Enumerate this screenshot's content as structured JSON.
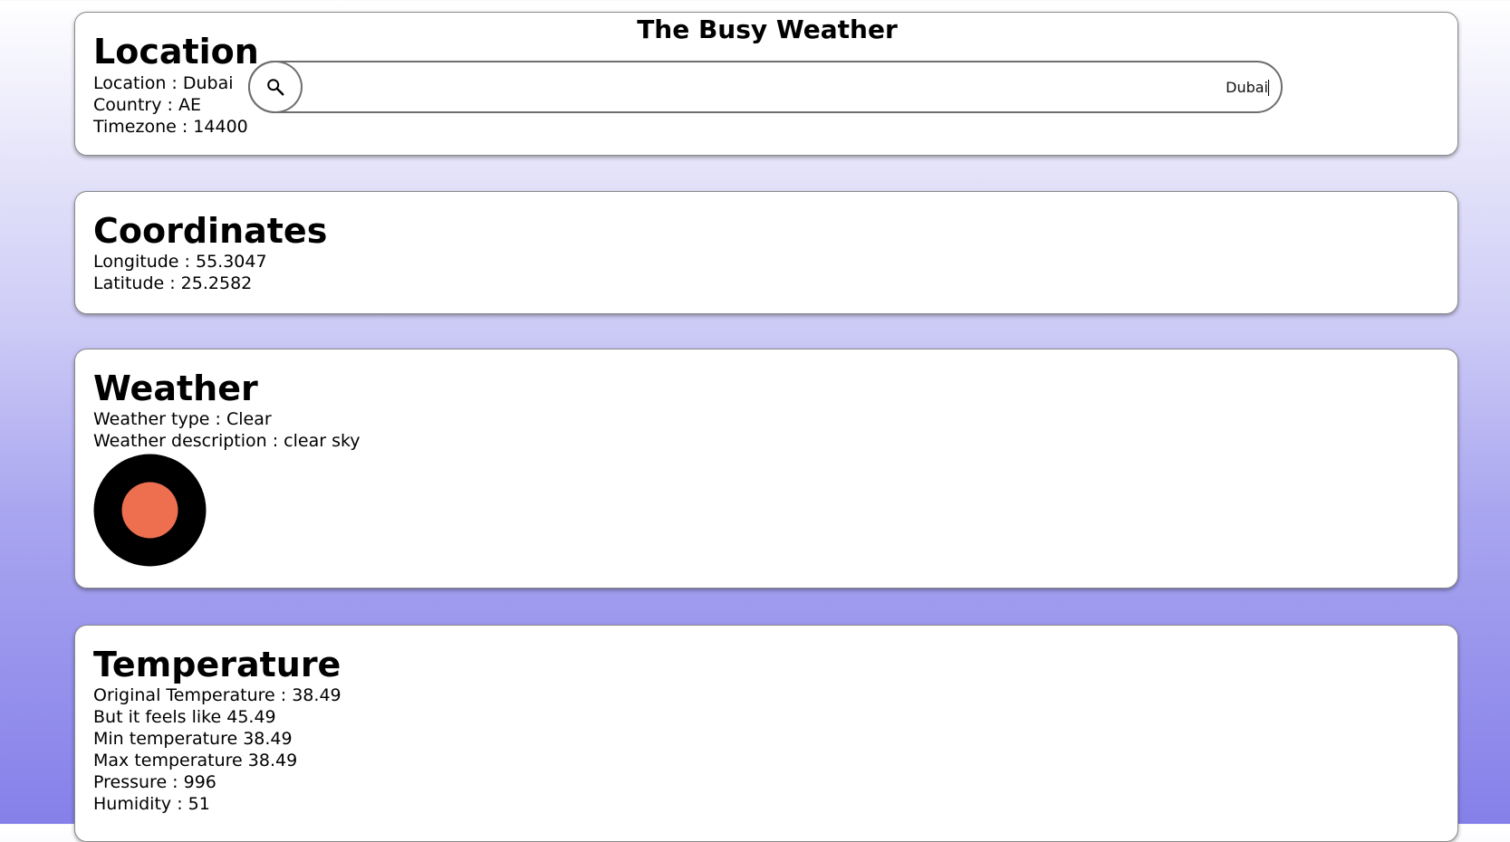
{
  "app": {
    "title": "The Busy Weather"
  },
  "search": {
    "value": "Dubai",
    "icon": "search-icon"
  },
  "location": {
    "heading": "Location",
    "location_line": "Location : Dubai",
    "country_line": "Country : AE",
    "timezone_line": "Timezone : 14400"
  },
  "coordinates": {
    "heading": "Coordinates",
    "longitude_line": "Longitude : 55.3047",
    "latitude_line": "Latitude : 25.2582"
  },
  "weather": {
    "heading": "Weather",
    "type_line": "Weather type : Clear",
    "description_line": "Weather description : clear sky",
    "icon": "clear-sky-sun-icon",
    "icon_outer_color": "#000000",
    "icon_inner_color": "#ee6e50"
  },
  "temperature": {
    "heading": "Temperature",
    "original_line": "Original Temperature : 38.49",
    "feels_like_line": "But it feels like 45.49",
    "min_line": "Min temperature 38.49",
    "max_line": "Max temperature 38.49",
    "pressure_line": "Pressure : 996",
    "humidity_line": "Humidity : 51"
  },
  "colors": {
    "background_top": "#ffffff",
    "background_bottom": "#8580e9",
    "card_background": "#ffffff"
  }
}
